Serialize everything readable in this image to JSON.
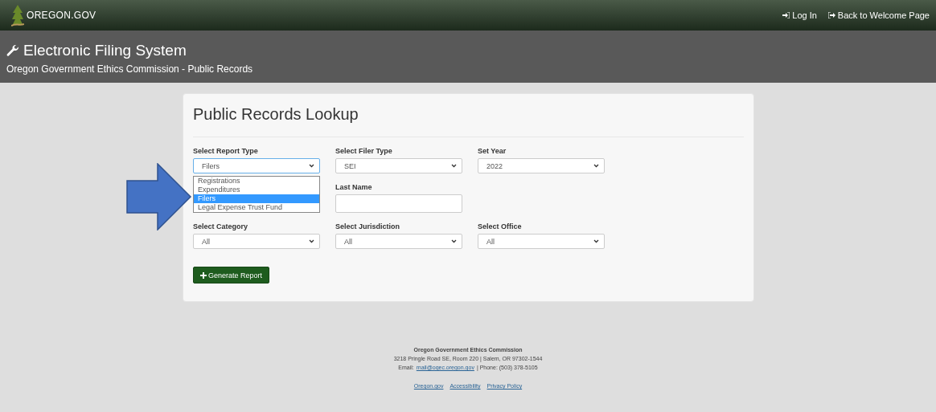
{
  "top_bar": {
    "logo": "OREGON.GOV",
    "links": [
      {
        "label": "Log In",
        "kind": "login"
      },
      {
        "label": "Back to Welcome Page",
        "kind": "back"
      }
    ]
  },
  "header": {
    "title": "Electronic Filing System",
    "subtitle": "Oregon Government Ethics Commission - Public Records"
  },
  "card": {
    "title": "Public Records Lookup",
    "rows": [
      [
        {
          "label": "Select Report Type",
          "kind": "select",
          "value": "Filers",
          "open": true
        },
        {
          "label": "Select Filer Type",
          "kind": "select",
          "value": "SEI",
          "open": false
        },
        {
          "label": "Set Year",
          "kind": "select",
          "value": "2022",
          "open": false
        }
      ],
      [
        {
          "kind": "empty"
        },
        {
          "label": "Last Name",
          "kind": "input"
        },
        {
          "kind": "empty"
        }
      ],
      [
        {
          "label": "Select Category",
          "kind": "select",
          "value": "All",
          "open": false
        },
        {
          "label": "Select Jurisdiction",
          "kind": "select",
          "value": "All",
          "open": false
        },
        {
          "label": "Select Office",
          "kind": "select",
          "value": "All",
          "open": false
        }
      ]
    ],
    "dropdown_options": [
      {
        "label": "Registrations",
        "selected": false
      },
      {
        "label": "Expenditures",
        "selected": false
      },
      {
        "label": "Filers",
        "selected": true
      },
      {
        "label": "Legal Expense Trust Fund",
        "selected": false
      }
    ],
    "button": "Generate Report"
  },
  "footer": {
    "org": "Oregon Government Ethics Commission",
    "address": "3218 Pringle Road SE, Room 220 | Salem, OR 97302-1544",
    "email_label": "Email:",
    "email": "mail@ogec.oregon.gov",
    "phone": "| Phone: (503) 378-5105",
    "links": [
      "Oregon.gov",
      "Accessibility",
      "Privacy Policy"
    ]
  }
}
